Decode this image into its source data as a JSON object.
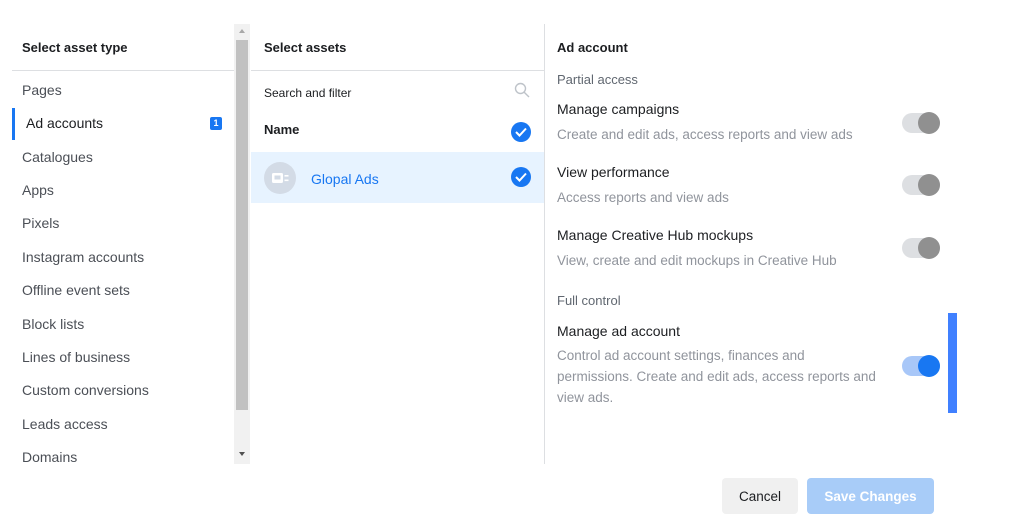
{
  "left": {
    "header": "Select asset type",
    "items": [
      {
        "label": "Pages"
      },
      {
        "label": "Ad accounts",
        "badge": "1",
        "selected": true
      },
      {
        "label": "Catalogues"
      },
      {
        "label": "Apps"
      },
      {
        "label": "Pixels"
      },
      {
        "label": "Instagram accounts"
      },
      {
        "label": "Offline event sets"
      },
      {
        "label": "Block lists"
      },
      {
        "label": "Lines of business"
      },
      {
        "label": "Custom conversions"
      },
      {
        "label": "Leads access"
      },
      {
        "label": "Domains"
      }
    ]
  },
  "middle": {
    "header": "Select assets",
    "search_placeholder": "Search and filter",
    "name_header": "Name",
    "asset": {
      "name": "Glopal Ads",
      "checked": true
    }
  },
  "right": {
    "header": "Ad account",
    "partial_heading": "Partial access",
    "full_heading": "Full control",
    "permissions": [
      {
        "title": "Manage campaigns",
        "desc": "Create and edit ads, access reports and view ads",
        "enabled": false
      },
      {
        "title": "View performance",
        "desc": "Access reports and view ads",
        "enabled": false
      },
      {
        "title": "Manage Creative Hub mockups",
        "desc": "View, create and edit mockups in Creative Hub",
        "enabled": false
      },
      {
        "title": "Manage ad account",
        "desc": "Control ad account settings, finances and permissions. Create and edit ads, access reports and view ads.",
        "enabled": true
      }
    ]
  },
  "footer": {
    "cancel": "Cancel",
    "save": "Save Changes"
  },
  "colors": {
    "accent": "#1877f2",
    "selected_row": "#e7f3ff",
    "save_disabled": "#a8ccf8"
  }
}
